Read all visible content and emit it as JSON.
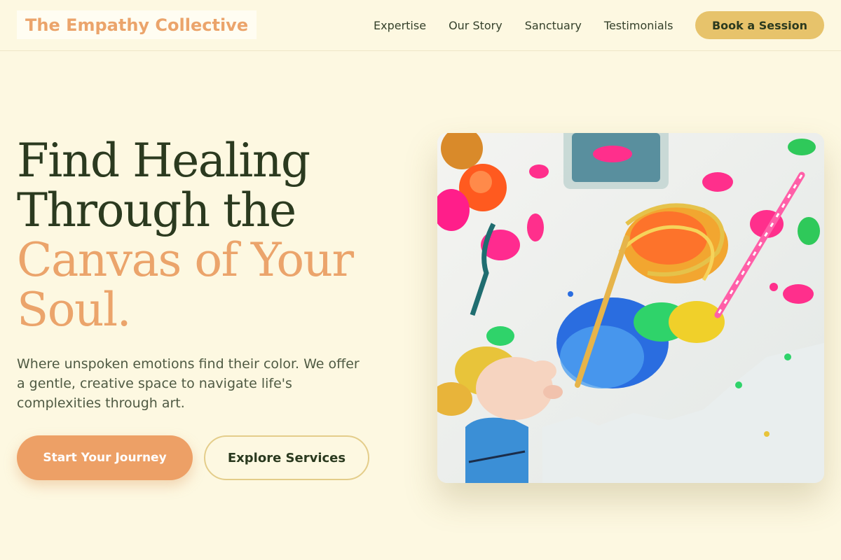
{
  "header": {
    "logo": "The Empathy Collective",
    "nav": [
      {
        "label": "Expertise"
      },
      {
        "label": "Our Story"
      },
      {
        "label": "Sanctuary"
      },
      {
        "label": "Testimonials"
      }
    ],
    "cta_label": "Book a Session"
  },
  "hero": {
    "title_line1": "Find Healing",
    "title_line2": "Through the",
    "title_accent_line1": "Canvas of Your",
    "title_accent_line2": "Soul.",
    "subtitle": "Where unspoken emotions find their color. We offer a gentle, creative space to navigate life's complexities through art.",
    "primary_label": "Start Your Journey",
    "secondary_label": "Explore Services",
    "image_subject": "child-painting-with-colorful-paint"
  },
  "colors": {
    "background": "#fdf8e1",
    "accent": "#eba46b",
    "gold": "#e7c36b",
    "text_dark": "#2b3a1f"
  }
}
